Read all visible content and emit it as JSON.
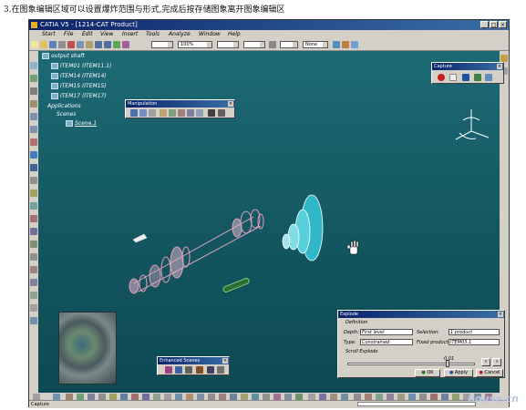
{
  "caption": "3.在图象编辑区域可以设置爆炸范围与形式,完成后按存储图象离开图象编辑区",
  "window": {
    "title": "CATIA V5 - [1214-CAT Product]",
    "colors": {
      "titlebar": "#0a246a",
      "viewport": "#135660",
      "chrome": "#d4d0c8"
    }
  },
  "menu": [
    "Start",
    "File",
    "Edit",
    "View",
    "Insert",
    "Tools",
    "Analyze",
    "Window",
    "Help"
  ],
  "toolbar": {
    "zoom_combo": "100%",
    "none_combo": "None"
  },
  "tree": {
    "root": "output shaft",
    "items": [
      "ITEM01 (ITEM11.1)",
      "ITEM14 (ITEM14)",
      "ITEM15 (ITEM15)",
      "ITEM17 (ITEM17)"
    ],
    "applications": "Applications",
    "scenes": "Scenes",
    "scene": "Scene.1"
  },
  "manipulation_panel": {
    "title": "Manipulation"
  },
  "capture_panel": {
    "title": "Capture"
  },
  "enhanced_scenes_panel": {
    "title": "Enhanced Scenes"
  },
  "explode_dialog": {
    "title": "Explode",
    "definition_label": "Definition",
    "depth_label": "Depth:",
    "depth_value": "First level",
    "selection_label": "Selection:",
    "selection_value": "1 product",
    "type_label": "Type:",
    "type_value": "Constrained",
    "fixed_label": "Fixed product:",
    "fixed_value": "ITEM03.1",
    "scroll_label": "Scroll Explode",
    "scroll_value": "0.01",
    "ok": "OK",
    "apply": "Apply",
    "cancel": "Cancel"
  },
  "status": {
    "text": "Capture"
  },
  "watermark": "house.cn"
}
